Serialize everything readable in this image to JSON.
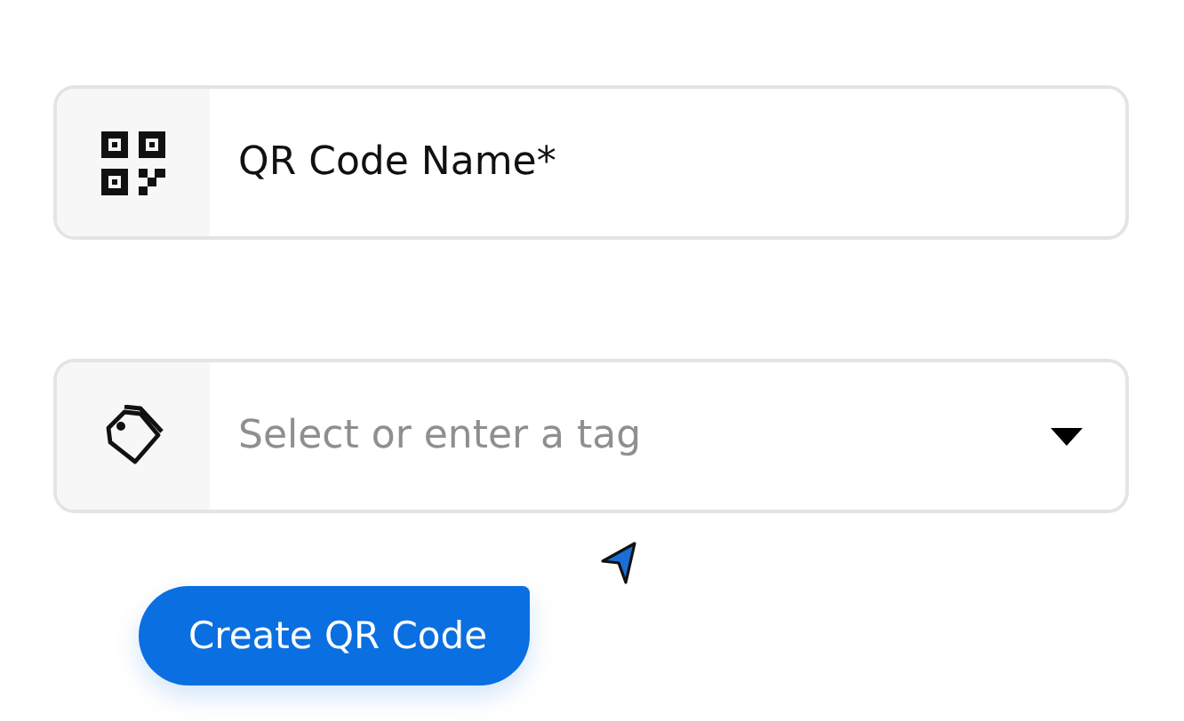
{
  "name_field": {
    "value": "QR Code Name*"
  },
  "tag_field": {
    "placeholder": "Select or enter a tag"
  },
  "create_button": {
    "label": "Create QR Code"
  }
}
